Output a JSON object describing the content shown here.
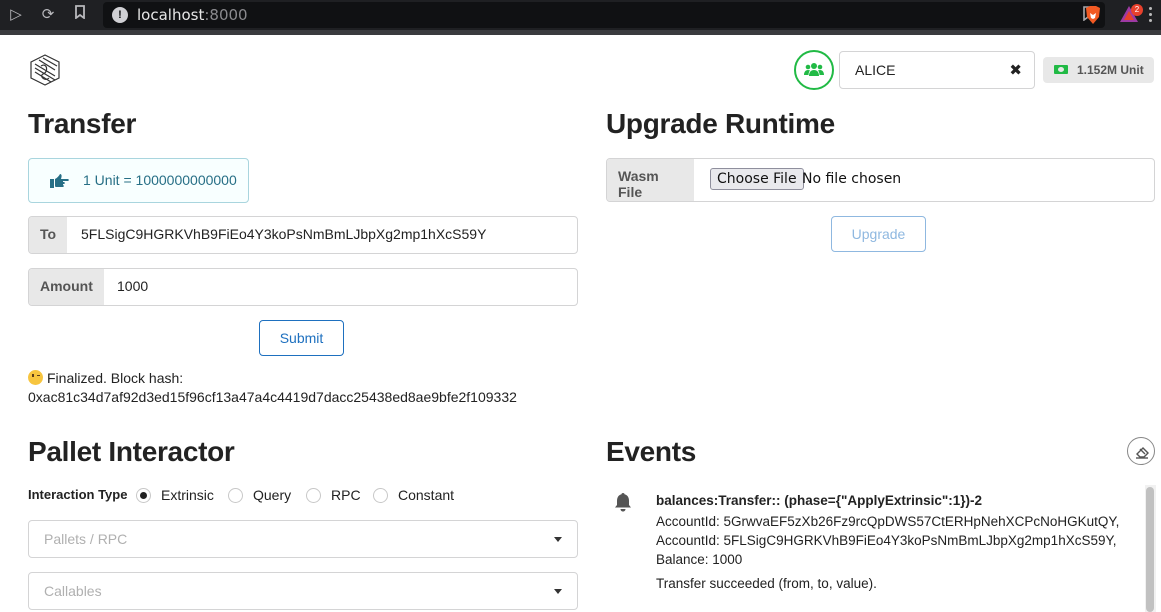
{
  "browser": {
    "url_host": "localhost",
    "url_port": ":8000",
    "notification_count": "2"
  },
  "header": {
    "account_name": "ALICE",
    "clear_symbol": "✖",
    "balance": "1.152M Unit"
  },
  "transfer": {
    "title": "Transfer",
    "info": "1 Unit = 1000000000000",
    "to_label": "To",
    "to_value": "5FLSigC9HGRKVhB9FiEo4Y3koPsNmBmLJbpXg2mp1hXcS59Y",
    "amount_label": "Amount",
    "amount_value": "1000",
    "submit_label": "Submit",
    "status_line1": "Finalized. Block hash:",
    "status_line2": "0xac81c34d7af92d3ed15f96cf13a47a4c4419d7dacc25438ed8ae9bfe2f109332"
  },
  "upgrade": {
    "title": "Upgrade Runtime",
    "wasm_label": "Wasm File",
    "choose_label": "Choose File",
    "no_file": "No file chosen",
    "upgrade_label": "Upgrade"
  },
  "pallet": {
    "title": "Pallet Interactor",
    "interaction_type_label": "Interaction Type",
    "options": [
      "Extrinsic",
      "Query",
      "RPC",
      "Constant"
    ],
    "selected": "Extrinsic",
    "pallets_placeholder": "Pallets / RPC",
    "callables_placeholder": "Callables"
  },
  "events": {
    "title": "Events",
    "items": [
      {
        "header": "balances:Transfer:: (phase={\"ApplyExtrinsic\":1})-2",
        "lines": [
          "AccountId: 5GrwvaEF5zXb26Fz9rcQpDWS57CtERHpNehXCPcNoHGKutQY,",
          "AccountId: 5FLSigC9HGRKVhB9FiEo4Y3koPsNmBmLJbpXg2mp1hXcS59Y,",
          "Balance: 1000"
        ],
        "description": "Transfer succeeded (from, to, value)."
      }
    ]
  },
  "colors": {
    "accent_green": "#21ba45",
    "primary_blue": "#1e70bf",
    "info_text": "#276f86"
  }
}
